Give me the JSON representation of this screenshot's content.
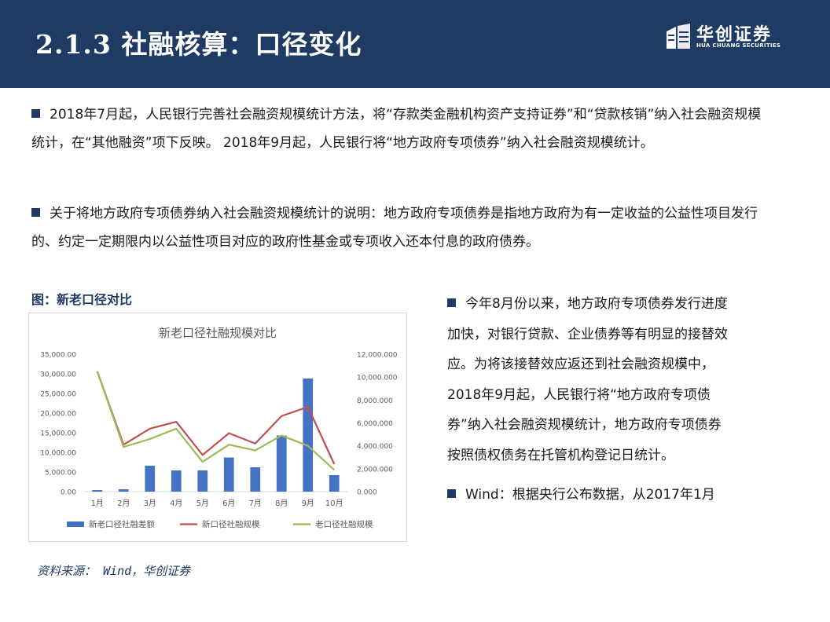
{
  "header": {
    "title": "2.1.3 社融核算：口径变化",
    "logo_cn": "华创证券",
    "logo_en": "HUA CHUANG SECURITIES",
    "bg_color": "#1f3a63"
  },
  "body_paragraphs": [
    "2018年7月起，人民银行完善社会融资规模统计方法，将“存款类金融机构资产支持证券”和“贷款核销”纳入社会融资规模统计，在“其他融资”项下反映。 2018年9月起，人民银行将“地方政府专项债券”纳入社会融资规模统计。",
    "关于将地方政府专项债券纳入社会融资规模统计的说明：地方政府专项债券是指地方政府为有一定收益的公益性项目发行的、约定一定期限内以公益性项目对应的政府性基金或专项收入还本付息的政府债券。"
  ],
  "figure": {
    "label": "图：新老口径对比",
    "source": "资料来源： Wind，华创证券"
  },
  "chart_data": {
    "type": "bar",
    "title": "新老口径社融规模对比",
    "categories": [
      "1月",
      "2月",
      "3月",
      "4月",
      "5月",
      "6月",
      "7月",
      "8月",
      "9月",
      "10月"
    ],
    "left_ticks": [
      "35,000.00",
      "30,000.00",
      "25,000.00",
      "20,000.00",
      "15,000.00",
      "10,000.00",
      "5,000.00",
      "0.00"
    ],
    "right_ticks": [
      "12,000.000",
      "10,000.000",
      "8,000.000",
      "6,000.000",
      "4,000.000",
      "2,000.000",
      "0.000"
    ],
    "ylim_left": [
      0,
      35000
    ],
    "ylim_right": [
      0,
      12000
    ],
    "series": [
      {
        "name": "新老口径社融差额",
        "type": "bar",
        "axis": "left",
        "color": "#4472c4",
        "values": [
          400,
          600,
          6600,
          5400,
          5400,
          8700,
          6200,
          14300,
          28800,
          4200
        ]
      },
      {
        "name": "新口径社融规模",
        "type": "line",
        "axis": "right",
        "color": "#c0504d",
        "values": [
          10500,
          4100,
          5500,
          6100,
          3200,
          5100,
          4200,
          6600,
          7400,
          2400
        ]
      },
      {
        "name": "老口径社融规模",
        "type": "line",
        "axis": "right",
        "color": "#9bbb59",
        "values": [
          10500,
          3900,
          4600,
          5500,
          2600,
          4100,
          3600,
          4900,
          4000,
          1900
        ]
      }
    ],
    "legend_position": "bottom"
  },
  "right_column": {
    "para1": "今年8月份以来，地方政府专项债券发行进度加快，对银行贷款、企业债券等有明显的接替效应。为将该接替效应返还到社会融资规模中，2018年9月起，人民银行将“地方政府专项债券”纳入社会融资规模统计，地方政府专项债券按照债权债务在托管机构登记日统计。",
    "para2": "Wind：根据央行公布数据，从2017年1月"
  }
}
